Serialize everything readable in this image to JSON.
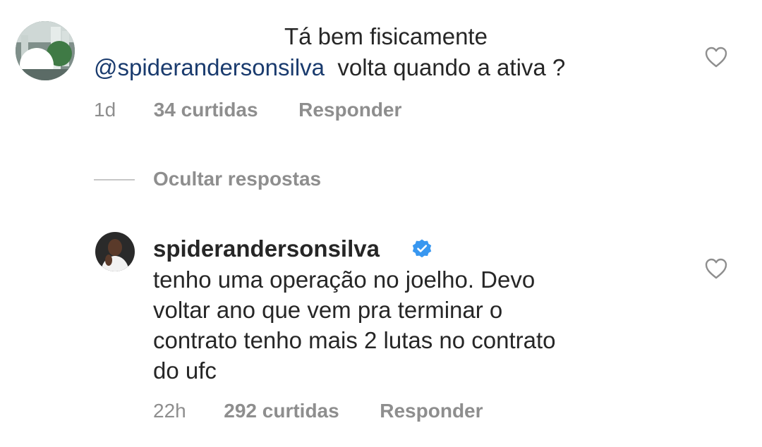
{
  "top_comment": {
    "line1": "Tá bem fisicamente",
    "mention": "@spiderandersonsilva",
    "line2_rest": "volta quando a ativa ?",
    "time": "1d",
    "likes": "34 curtidas",
    "reply_label": "Responder"
  },
  "hide_replies_label": "Ocultar respostas",
  "reply": {
    "username": "spiderandersonsilva",
    "lines": [
      "tenho uma operação no joelho. Devo",
      "voltar ano que vem pra terminar o",
      "contrato tenho mais 2 lutas no contrato",
      "do ufc"
    ],
    "time": "22h",
    "likes": "292 curtidas",
    "reply_label": "Responder"
  },
  "colors": {
    "text": "#262626",
    "meta": "#8e8e8e",
    "mention": "#1a3b6e",
    "verified": "#3897f0"
  },
  "icons": {
    "like": "heart-outline-icon",
    "verified": "verified-badge-icon"
  }
}
